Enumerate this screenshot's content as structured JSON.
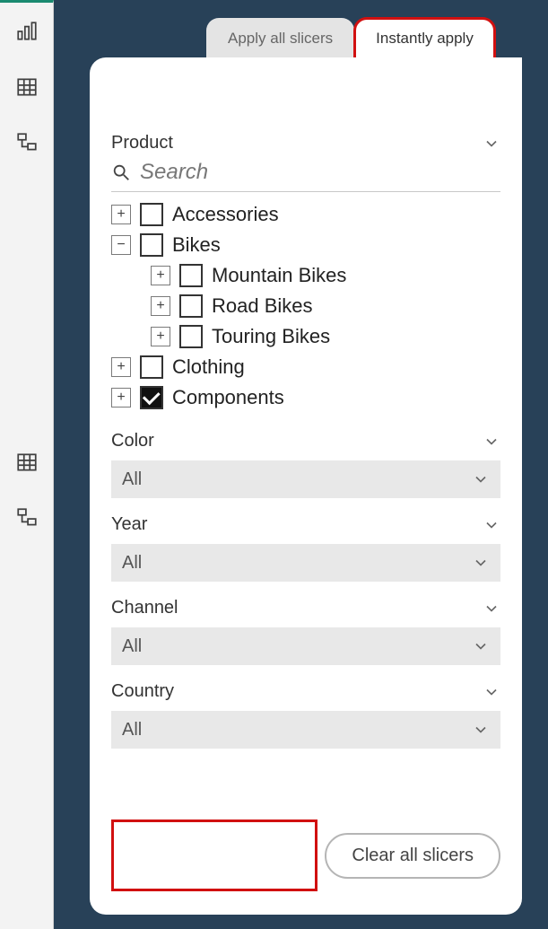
{
  "tabs": {
    "apply_all": "Apply all slicers",
    "instantly": "Instantly apply"
  },
  "product": {
    "title": "Product",
    "search_placeholder": "Search",
    "items": [
      {
        "label": "Accessories",
        "expanded": false,
        "checked": false,
        "level": 1
      },
      {
        "label": "Bikes",
        "expanded": true,
        "checked": false,
        "level": 1
      },
      {
        "label": "Mountain Bikes",
        "expanded": false,
        "checked": false,
        "level": 2
      },
      {
        "label": "Road Bikes",
        "expanded": false,
        "checked": false,
        "level": 2
      },
      {
        "label": "Touring Bikes",
        "expanded": false,
        "checked": false,
        "level": 2
      },
      {
        "label": "Clothing",
        "expanded": false,
        "checked": false,
        "level": 1
      },
      {
        "label": "Components",
        "expanded": false,
        "checked": true,
        "level": 1
      }
    ]
  },
  "slicers": [
    {
      "title": "Color",
      "value": "All"
    },
    {
      "title": "Year",
      "value": "All"
    },
    {
      "title": "Channel",
      "value": "All"
    },
    {
      "title": "Country",
      "value": "All"
    }
  ],
  "clear_button": "Clear all slicers"
}
